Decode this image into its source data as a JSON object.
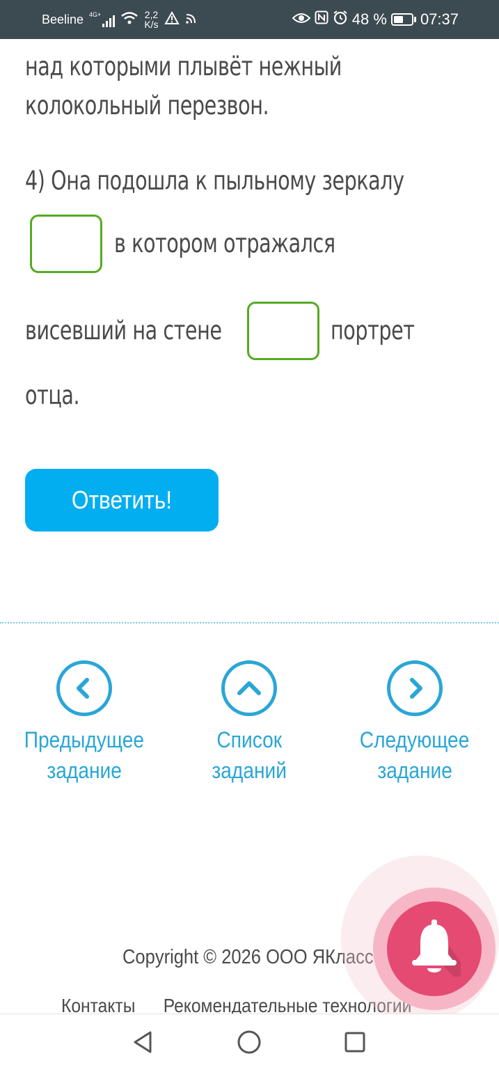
{
  "status_bar": {
    "carrier": "Beeline",
    "network": "4G+",
    "speed_value": "2,2",
    "speed_unit": "K/s",
    "battery_percent": "48 %",
    "time": "07:37"
  },
  "exercise": {
    "lines": [
      " над которыми плывёт нежный",
      "колокольный перезвон.",
      "4) Она подошла к пыльному зеркалу",
      "в котором отражался",
      "висевший на стене",
      "портрет",
      "отца."
    ],
    "answer_button": "Ответить!"
  },
  "navigation": {
    "prev": {
      "line1": "Предыдущее",
      "line2": "задание"
    },
    "list": {
      "line1": "Список",
      "line2": "заданий"
    },
    "next": {
      "line1": "Следующее",
      "line2": "задание"
    }
  },
  "footer": {
    "copyright": "Copyright © 2026 ООО ЯКласс",
    "links": [
      "Контакты",
      "Рекомендательные технологии"
    ]
  },
  "colors": {
    "accent": "#02aef0",
    "link": "#2aa6d6",
    "gap_border": "#55aa22",
    "bell": "#e54a72",
    "status_bar": "#3c4a52"
  }
}
